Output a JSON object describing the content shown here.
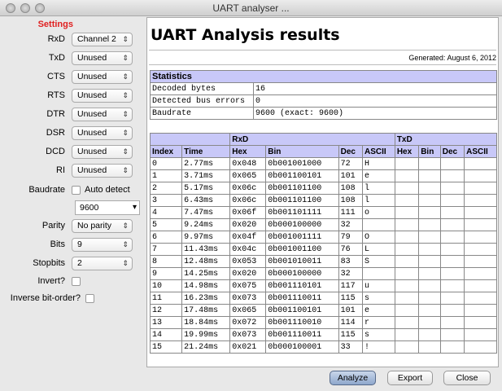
{
  "window": {
    "title": "UART analyser ..."
  },
  "settings": {
    "heading": "Settings",
    "signals": [
      {
        "label": "RxD",
        "value": "Channel 2"
      },
      {
        "label": "TxD",
        "value": "Unused"
      },
      {
        "label": "CTS",
        "value": "Unused"
      },
      {
        "label": "RTS",
        "value": "Unused"
      },
      {
        "label": "DTR",
        "value": "Unused"
      },
      {
        "label": "DSR",
        "value": "Unused"
      },
      {
        "label": "DCD",
        "value": "Unused"
      },
      {
        "label": "RI",
        "value": "Unused"
      }
    ],
    "baudrate_label": "Baudrate",
    "auto_detect_label": "Auto detect",
    "baudrate_value": "9600",
    "parity_label": "Parity",
    "parity_value": "No parity",
    "bits_label": "Bits",
    "bits_value": "9",
    "stopbits_label": "Stopbits",
    "stopbits_value": "2",
    "invert_label": "Invert?",
    "inverse_label": "Inverse bit-order?"
  },
  "report": {
    "title": "UART Analysis results",
    "generated": "Generated: August 6, 2012",
    "stats_heading": "Statistics",
    "stats": [
      [
        "Decoded bytes",
        "16"
      ],
      [
        "Detected bus errors",
        "0"
      ],
      [
        "Baudrate",
        "9600 (exact: 9600)"
      ]
    ],
    "group_rxd": "RxD",
    "group_txd": "TxD",
    "columns": [
      "Index",
      "Time",
      "Hex",
      "Bin",
      "Dec",
      "ASCII",
      "Hex",
      "Bin",
      "Dec",
      "ASCII"
    ],
    "rows": [
      [
        "0",
        "2.77ms",
        "0x048",
        "0b001001000",
        "72",
        "H"
      ],
      [
        "1",
        "3.71ms",
        "0x065",
        "0b001100101",
        "101",
        "e"
      ],
      [
        "2",
        "5.17ms",
        "0x06c",
        "0b001101100",
        "108",
        "l"
      ],
      [
        "3",
        "6.43ms",
        "0x06c",
        "0b001101100",
        "108",
        "l"
      ],
      [
        "4",
        "7.47ms",
        "0x06f",
        "0b001101111",
        "111",
        "o"
      ],
      [
        "5",
        "9.24ms",
        "0x020",
        "0b000100000",
        "32",
        ""
      ],
      [
        "6",
        "9.97ms",
        "0x04f",
        "0b001001111",
        "79",
        "O"
      ],
      [
        "7",
        "11.43ms",
        "0x04c",
        "0b001001100",
        "76",
        "L"
      ],
      [
        "8",
        "12.48ms",
        "0x053",
        "0b001010011",
        "83",
        "S"
      ],
      [
        "9",
        "14.25ms",
        "0x020",
        "0b000100000",
        "32",
        ""
      ],
      [
        "10",
        "14.98ms",
        "0x075",
        "0b001110101",
        "117",
        "u"
      ],
      [
        "11",
        "16.23ms",
        "0x073",
        "0b001110011",
        "115",
        "s"
      ],
      [
        "12",
        "17.48ms",
        "0x065",
        "0b001100101",
        "101",
        "e"
      ],
      [
        "13",
        "18.84ms",
        "0x072",
        "0b001110010",
        "114",
        "r"
      ],
      [
        "14",
        "19.99ms",
        "0x073",
        "0b001110011",
        "115",
        "s"
      ],
      [
        "15",
        "21.24ms",
        "0x021",
        "0b000100001",
        "33",
        "!"
      ]
    ]
  },
  "buttons": {
    "analyze": "Analyze",
    "export": "Export",
    "close": "Close"
  }
}
